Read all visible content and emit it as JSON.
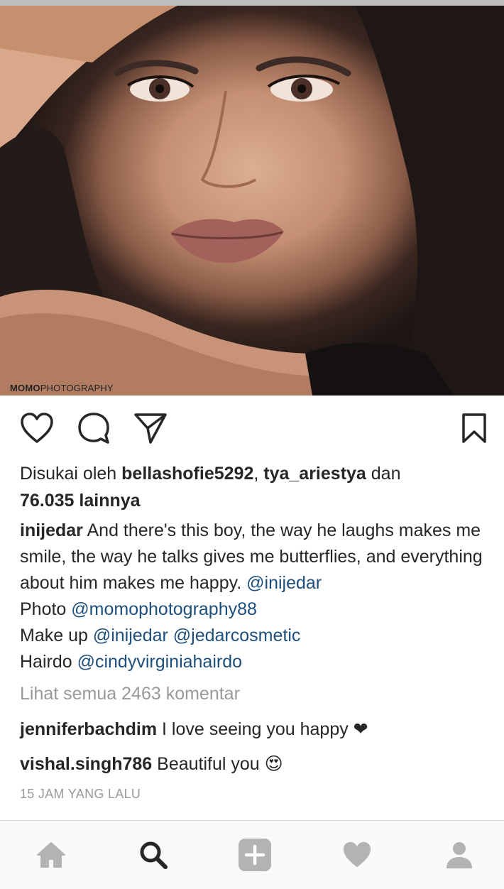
{
  "photo": {
    "watermark_bold": "MOMO",
    "watermark_rest": "PHOTOGRAPHY"
  },
  "actions": {
    "like_icon": "heart-outline-icon",
    "comment_icon": "comment-bubble-icon",
    "share_icon": "paper-plane-icon",
    "save_icon": "bookmark-icon"
  },
  "likes": {
    "prefix": "Disukai oleh ",
    "user1": "bellashofie5292",
    "sep": ", ",
    "user2": "tya_ariestya",
    "connector": " dan",
    "others": "76.035 lainnya"
  },
  "caption": {
    "username": "inijedar",
    "text": " And there's this boy, the way he laughs makes me smile, the way he talks gives me butterflies, and everything about him makes me happy. ",
    "mention_main": "@inijedar",
    "photo_label": "Photo ",
    "photo_mention": "@momophotography88",
    "makeup_label": "Make up ",
    "makeup_mention1": "@inijedar",
    "makeup_space": " ",
    "makeup_mention2": "@jedarcosmetic",
    "hair_label": "Hairdo ",
    "hair_mention": "@cindyvirginiahairdo"
  },
  "view_all_comments": "Lihat semua 2463 komentar",
  "comments": [
    {
      "username": "jenniferbachdim",
      "text": " I love seeing you happy ",
      "emoji": "❤"
    },
    {
      "username": "vishal.singh786",
      "text": " Beautiful you ",
      "emoji": "😍"
    }
  ],
  "timestamp": "15 JAM YANG LALU",
  "nav": {
    "home_icon": "home-icon",
    "search_icon": "search-icon",
    "add_icon": "add-post-icon",
    "activity_icon": "heart-icon",
    "profile_icon": "profile-icon"
  }
}
